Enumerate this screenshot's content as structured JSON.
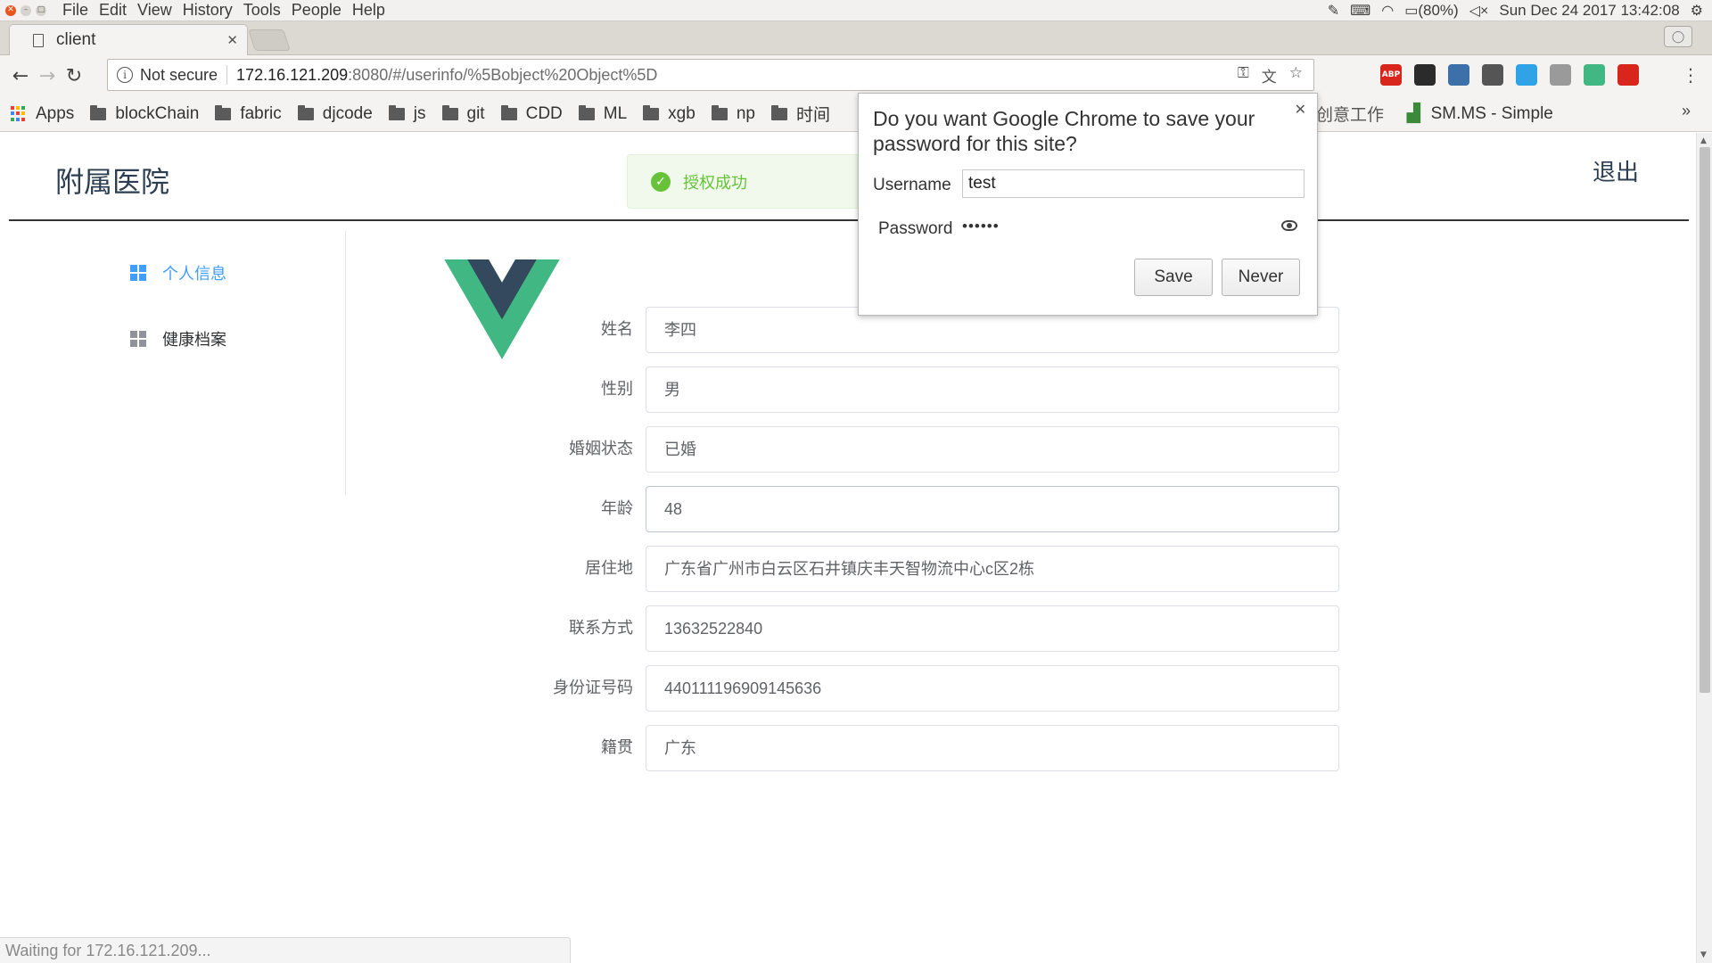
{
  "os_panel": {
    "menus": [
      "File",
      "Edit",
      "View",
      "History",
      "Tools",
      "People",
      "Help"
    ],
    "battery": "(80%)",
    "datetime": "Sun Dec 24 2017 13:42:08"
  },
  "browser": {
    "tab_title": "client",
    "security_label": "Not secure",
    "url_host": "172.16.121.209",
    "url_rest": ":8080/#/userinfo/%5Bobject%20Object%5D",
    "status_text": "Waiting for 172.16.121.209...",
    "bookmarks": [
      {
        "label": "Apps",
        "type": "apps"
      },
      {
        "label": "blockChain",
        "type": "folder"
      },
      {
        "label": "fabric",
        "type": "folder"
      },
      {
        "label": "djcode",
        "type": "folder"
      },
      {
        "label": "js",
        "type": "folder"
      },
      {
        "label": "git",
        "type": "folder"
      },
      {
        "label": "CDD",
        "type": "folder"
      },
      {
        "label": "ML",
        "type": "folder"
      },
      {
        "label": "xgb",
        "type": "folder"
      },
      {
        "label": "np",
        "type": "folder"
      },
      {
        "label": "时间",
        "type": "folder"
      }
    ],
    "bookmark_partial_1": "创意工作",
    "bookmark_partial_2": "SM.MS - Simple",
    "extensions": [
      {
        "name": "adblock-plus-icon",
        "label": "ABP",
        "color": "#d9261c"
      },
      {
        "name": "evernote-icon",
        "label": "",
        "color": "#2b2b2b"
      },
      {
        "name": "upload-icon",
        "label": "",
        "color": "#3d6fa8"
      },
      {
        "name": "film-icon",
        "label": "",
        "color": "#555555"
      },
      {
        "name": "v-extension-icon",
        "label": "",
        "color": "#2fa3e6"
      },
      {
        "name": "grid-extension-icon",
        "label": "",
        "color": "#9a9a9a"
      },
      {
        "name": "vue-devtools-icon",
        "label": "",
        "color": "#41b883"
      },
      {
        "name": "red-extension-icon",
        "label": "",
        "color": "#d9261c"
      }
    ]
  },
  "password_bubble": {
    "title": "Do you want Google Chrome to save your password for this site?",
    "username_label": "Username",
    "username_value": "test",
    "password_label": "Password",
    "password_value": "••••••",
    "save_label": "Save",
    "never_label": "Never"
  },
  "app": {
    "logo_text": "附属医院",
    "logout_label": "退出",
    "toast_text": "授权成功",
    "sidebar": [
      {
        "label": "个人信息",
        "active": true
      },
      {
        "label": "健康档案",
        "active": false
      }
    ],
    "fields": [
      {
        "label": "姓名",
        "value": "李四"
      },
      {
        "label": "性别",
        "value": "男"
      },
      {
        "label": "婚姻状态",
        "value": "已婚"
      },
      {
        "label": "年龄",
        "value": "48"
      },
      {
        "label": "居住地",
        "value": "广东省广州市白云区石井镇庆丰天智物流中心c区2栋"
      },
      {
        "label": "联系方式",
        "value": "13632522840"
      },
      {
        "label": "身份证号码",
        "value": "440111196909145636"
      },
      {
        "label": "籍贯",
        "value": "广东"
      }
    ]
  },
  "colors": {
    "accent": "#409eff",
    "success": "#67c23a",
    "vue_green": "#41b883",
    "vue_dark": "#34495e"
  }
}
